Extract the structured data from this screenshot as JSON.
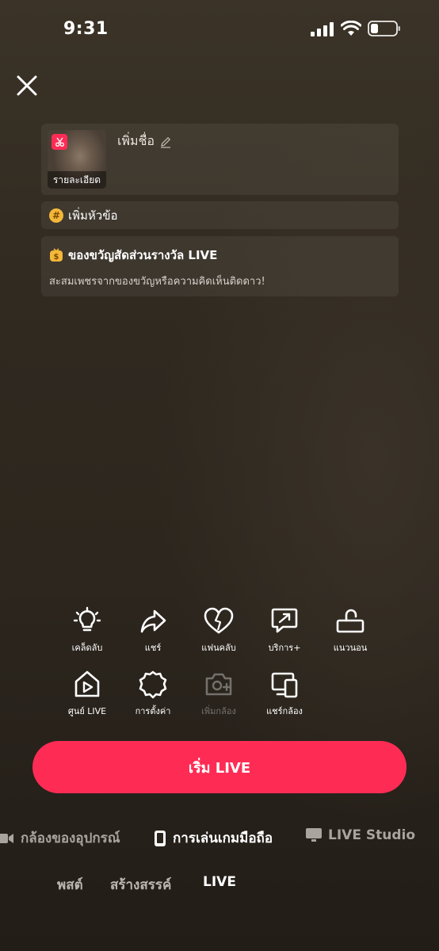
{
  "status_bar": {
    "time": "9:31",
    "icons": [
      "cellular-signal-icon",
      "wifi-icon",
      "battery-icon"
    ]
  },
  "header": {
    "close_icon": "close-icon"
  },
  "title_card": {
    "thumbnail_label": "รายละเอียด",
    "title_placeholder": "เพิ่มชื่อ",
    "edit_icon": "pencil-icon"
  },
  "topic_card": {
    "label": "เพิ่มหัวข้อ",
    "icon": "hashtag-icon"
  },
  "gift_card": {
    "title": "ของขวัญสัดส่วนรางวัล LIVE",
    "description": "สะสมเพชรจากของขวัญหรือความคิดเห็นติดดาว!",
    "icon": "gift-coin-icon"
  },
  "tools": [
    {
      "label": "เคล็ดลับ",
      "icon": "lightbulb-icon"
    },
    {
      "label": "แชร์",
      "icon": "share-icon"
    },
    {
      "label": "แฟนคลับ",
      "icon": "heart-icon"
    },
    {
      "label": "บริการ+",
      "icon": "service-icon"
    },
    {
      "label": "แนวนอน",
      "icon": "landscape-icon"
    },
    {
      "label": "ศูนย์ LIVE",
      "icon": "live-center-icon"
    },
    {
      "label": "การตั้งค่า",
      "icon": "settings-icon"
    },
    {
      "label": "เพิ่มกล้อง",
      "icon": "add-camera-icon",
      "disabled": true
    },
    {
      "label": "แชร์กล้อง",
      "icon": "share-camera-icon"
    }
  ],
  "go_live_button": {
    "label": "เริ่ม LIVE",
    "color": "#fe2c55"
  },
  "modes": [
    {
      "label": "กล้องของอุปกรณ์",
      "icon": "video-camera-icon"
    },
    {
      "label": "การเล่นเกมมือถือ",
      "icon": "phone-icon",
      "active": true
    },
    {
      "label": "LIVE Studio",
      "icon": "monitor-icon"
    }
  ],
  "tabs": [
    {
      "label": "พสต์"
    },
    {
      "label": "สร้างสรรค์"
    },
    {
      "label": "LIVE",
      "active": true
    }
  ]
}
